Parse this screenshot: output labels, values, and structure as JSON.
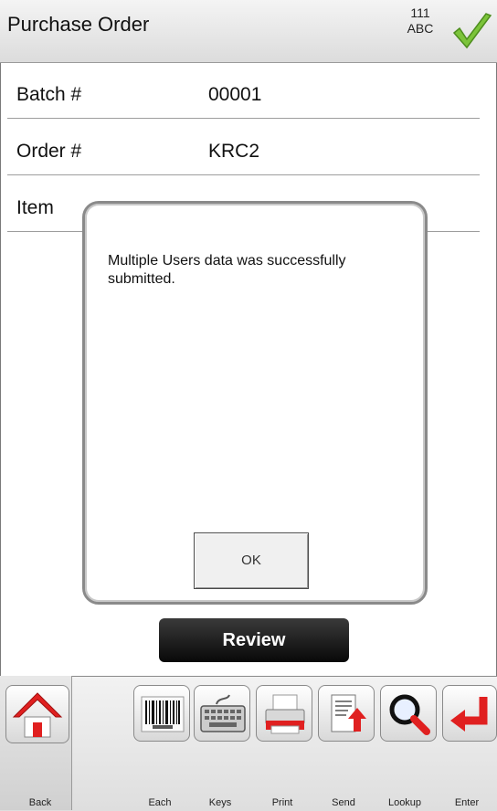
{
  "header": {
    "title": "Purchase Order",
    "user_line1": "111",
    "user_line2": "ABC"
  },
  "fields": [
    {
      "label": "Batch #",
      "value": "00001"
    },
    {
      "label": "Order #",
      "value": "KRC2"
    },
    {
      "label": "Item",
      "value": ""
    }
  ],
  "dialog": {
    "message": "Multiple Users data was successfully submitted.",
    "ok_label": "OK"
  },
  "review_label": "Review",
  "toolbar": {
    "back": "Back",
    "each": "Each",
    "keys": "Keys",
    "print": "Print",
    "send": "Send",
    "lookup": "Lookup",
    "enter": "Enter"
  },
  "colors": {
    "accent_red": "#e02020",
    "check_green": "#7cc43a"
  }
}
